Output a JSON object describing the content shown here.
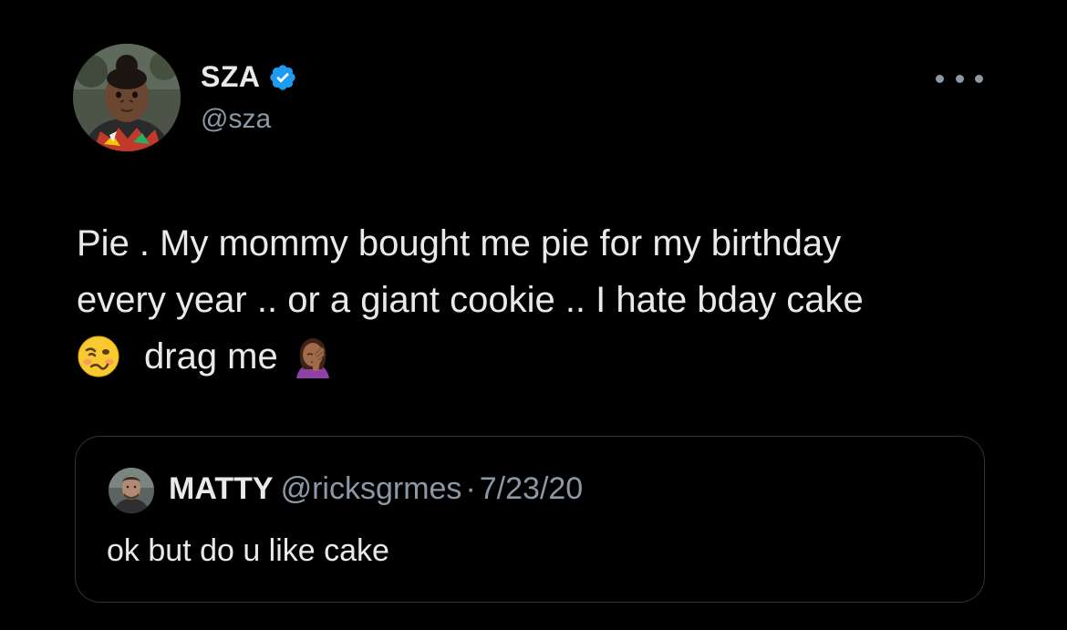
{
  "tweet": {
    "author": {
      "display_name": "SZA",
      "handle": "@sza",
      "verified": true,
      "avatar_icon": "toddler-portrait-avatar"
    },
    "more_icon": "more-options-icon",
    "text_lines": [
      "Pie . My mommy bought me pie for my birthday",
      "every year .. or a giant cookie .. I hate bday cake"
    ],
    "last_line": {
      "emoji_start": "woozy-face-emoji",
      "text": "drag me",
      "emoji_end": "woman-facepalming-emoji"
    }
  },
  "quoted_tweet": {
    "display_name": "MATTY",
    "handle": "@ricksgrmes",
    "separator": "·",
    "date": "7/23/20",
    "text": "ok but do u like cake",
    "avatar_icon": "man-portrait-avatar"
  },
  "colors": {
    "background": "#000000",
    "primary_text": "#e7e9ea",
    "secondary_text": "#8b98a5",
    "verified_blue": "#1d9bf0",
    "card_border": "#2f3336"
  }
}
